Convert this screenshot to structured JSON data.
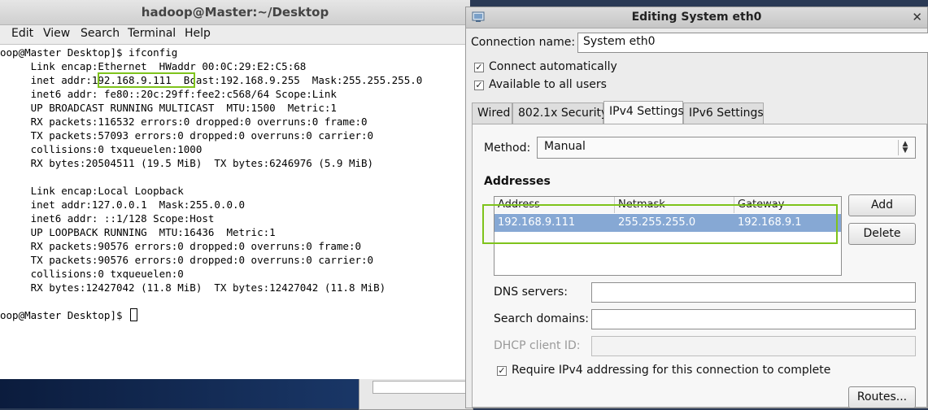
{
  "terminal": {
    "title": "hadoop@Master:~/Desktop",
    "menu": [
      "Edit",
      "View",
      "Search",
      "Terminal",
      "Help"
    ],
    "lines": [
      "oop@Master Desktop]$ ifconfig",
      "     Link encap:Ethernet  HWaddr 00:0C:29:E2:C5:68",
      "     inet addr:192.168.9.111  Bcast:192.168.9.255  Mask:255.255.255.0",
      "     inet6 addr: fe80::20c:29ff:fee2:c568/64 Scope:Link",
      "     UP BROADCAST RUNNING MULTICAST  MTU:1500  Metric:1",
      "     RX packets:116532 errors:0 dropped:0 overruns:0 frame:0",
      "     TX packets:57093 errors:0 dropped:0 overruns:0 carrier:0",
      "     collisions:0 txqueuelen:1000",
      "     RX bytes:20504511 (19.5 MiB)  TX bytes:6246976 (5.9 MiB)",
      "",
      "     Link encap:Local Loopback",
      "     inet addr:127.0.0.1  Mask:255.0.0.0",
      "     inet6 addr: ::1/128 Scope:Host",
      "     UP LOOPBACK RUNNING  MTU:16436  Metric:1",
      "     RX packets:90576 errors:0 dropped:0 overruns:0 frame:0",
      "     TX packets:90576 errors:0 dropped:0 overruns:0 carrier:0",
      "     collisions:0 txqueuelen:0",
      "     RX bytes:12427042 (11.8 MiB)  TX bytes:12427042 (11.8 MiB)",
      "",
      "oop@Master Desktop]$ "
    ]
  },
  "dialog": {
    "title": "Editing System eth0",
    "connection_name_label": "Connection name:",
    "connection_name_value": "System eth0",
    "connect_auto_label": "Connect automatically",
    "available_all_label": "Available to all users",
    "tabs": [
      "Wired",
      "802.1x Security",
      "IPv4 Settings",
      "IPv6 Settings"
    ],
    "method_label": "Method:",
    "method_value": "Manual",
    "addresses_heading": "Addresses",
    "columns": [
      "Address",
      "Netmask",
      "Gateway"
    ],
    "row": {
      "address": "192.168.9.111",
      "netmask": "255.255.255.0",
      "gateway": "192.168.9.1"
    },
    "add_label": "Add",
    "delete_label": "Delete",
    "dns_label": "DNS servers:",
    "search_label": "Search domains:",
    "dhcp_label": "DHCP client ID:",
    "require_label": "Require IPv4 addressing for this connection to complete",
    "routes_label": "Routes..."
  },
  "colors": {
    "highlight": "#7fc31c",
    "selected_row": "#86a8d4"
  }
}
